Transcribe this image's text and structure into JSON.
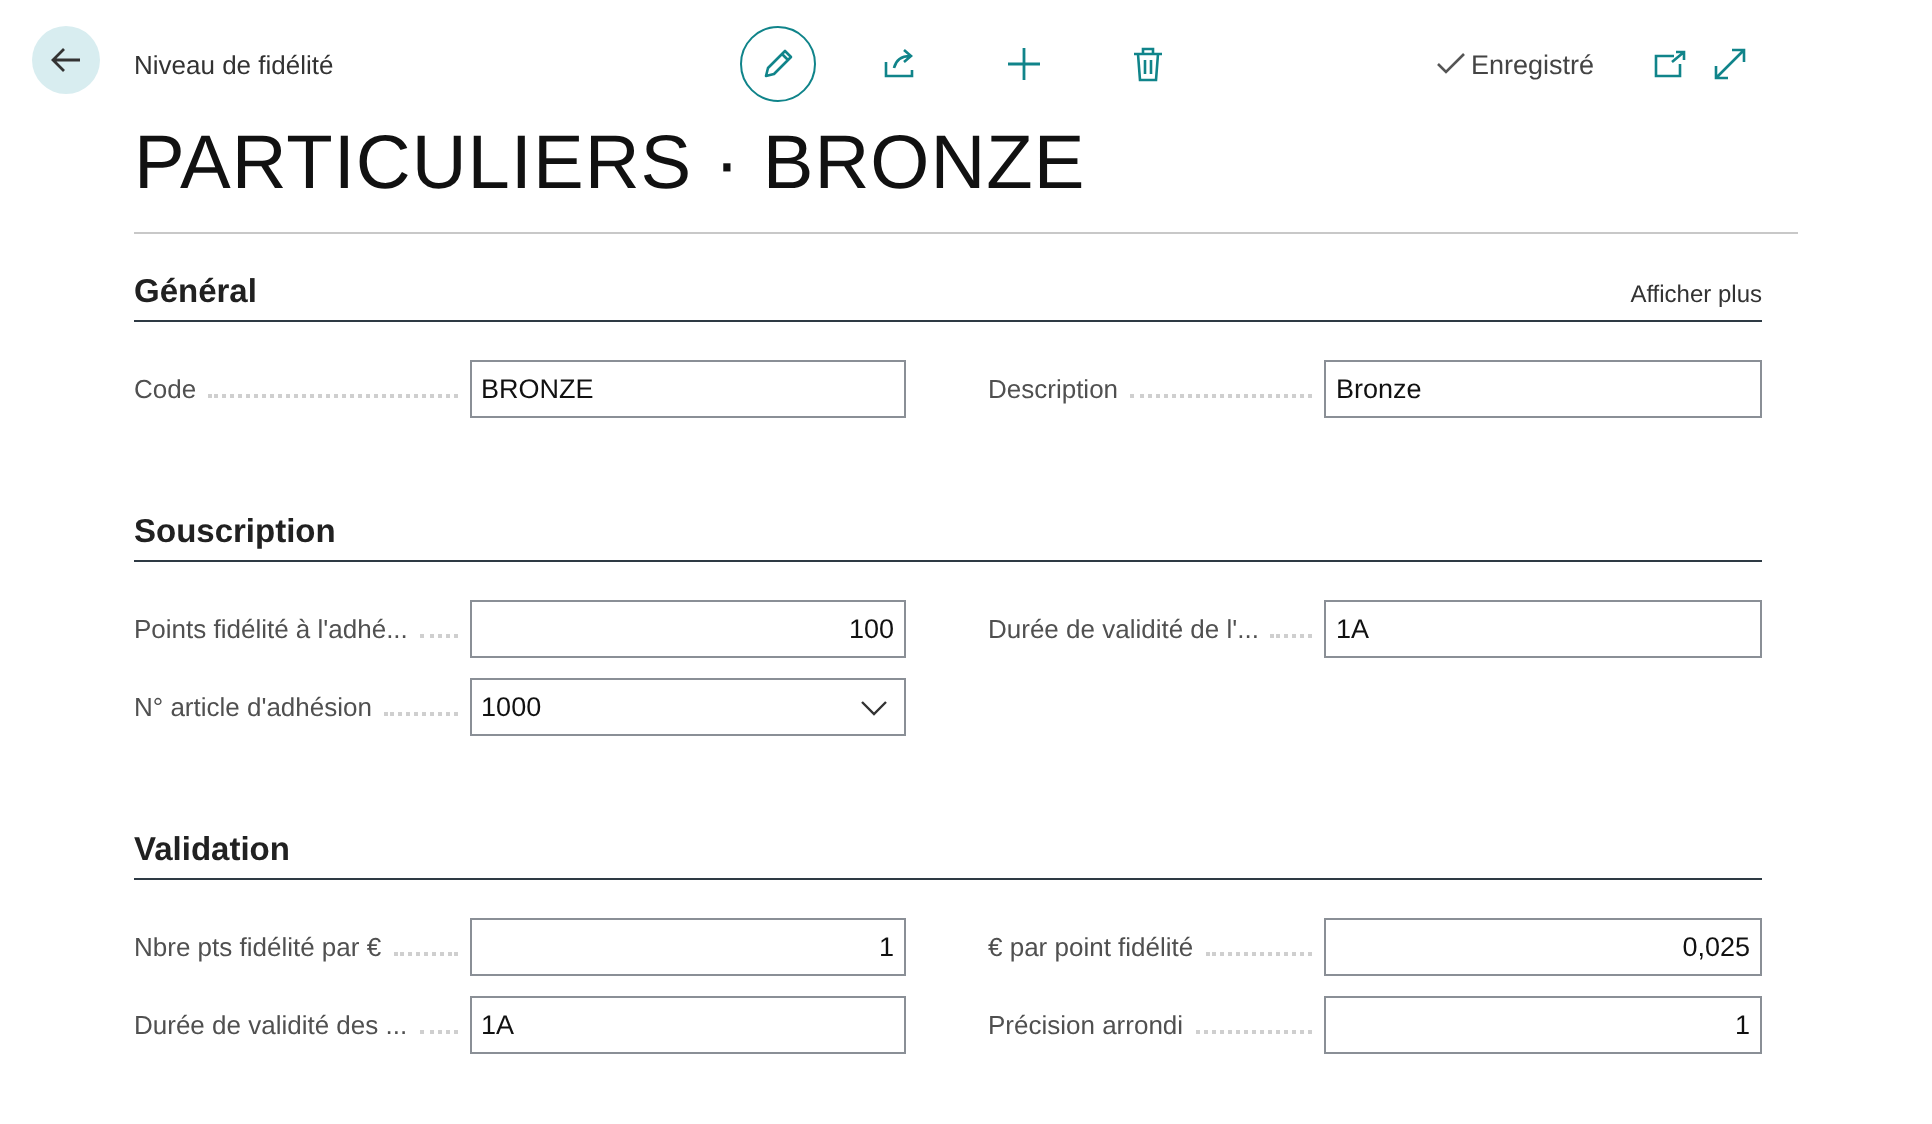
{
  "header": {
    "breadcrumb": "Niveau de fidélité",
    "status": "Enregistré",
    "title": "PARTICULIERS · BRONZE"
  },
  "sections": [
    {
      "title": "Général",
      "show_more": "Afficher plus",
      "fields": [
        {
          "label": "Code",
          "value": "BRONZE",
          "kind": "text"
        },
        {
          "label": "Description",
          "value": "Bronze",
          "kind": "text"
        }
      ]
    },
    {
      "title": "Souscription",
      "fields": [
        {
          "label": "Points fidélité à l'adhé...",
          "value": "100",
          "kind": "number"
        },
        {
          "label": "Durée de validité de l'...",
          "value": "1A",
          "kind": "text"
        },
        {
          "label": "N° article d'adhésion",
          "value": "1000",
          "kind": "dropdown"
        }
      ]
    },
    {
      "title": "Validation",
      "fields": [
        {
          "label": "Nbre pts fidélité par €",
          "value": "1",
          "kind": "number"
        },
        {
          "label": "€ par point fidélité",
          "value": "0,025",
          "kind": "number"
        },
        {
          "label": "Durée de validité des ...",
          "value": "1A",
          "kind": "text"
        },
        {
          "label": "Précision arrondi",
          "value": "1",
          "kind": "number"
        }
      ]
    }
  ]
}
